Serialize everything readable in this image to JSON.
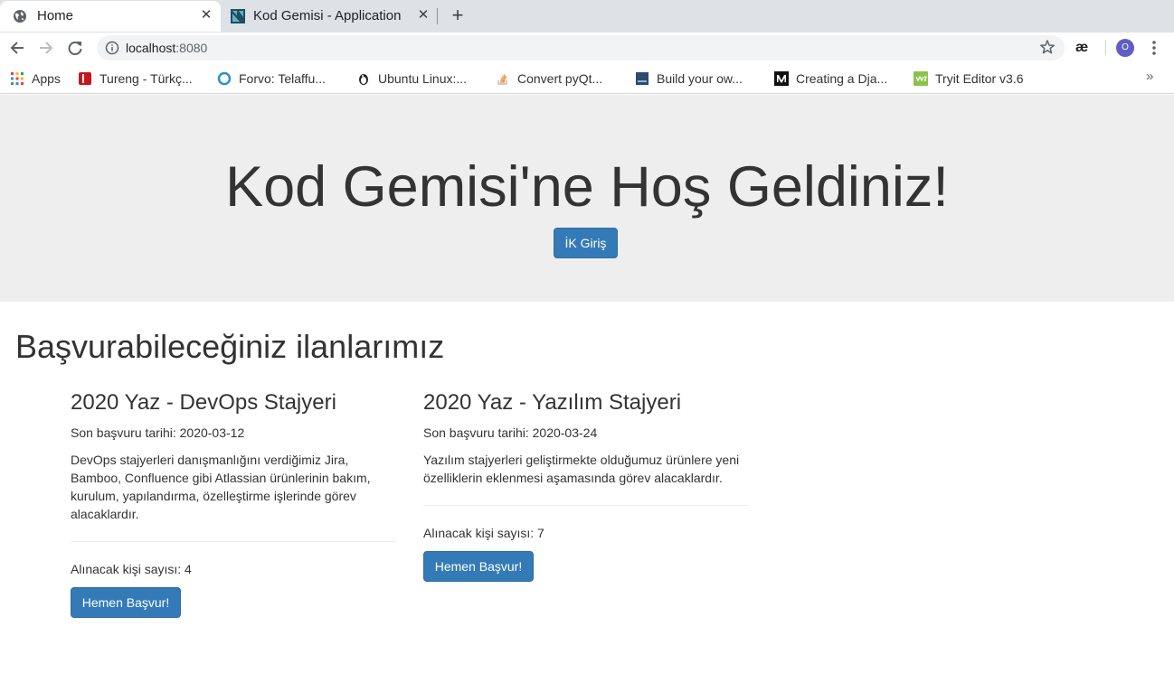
{
  "browser": {
    "tabs": [
      {
        "title": "Home",
        "favicon": "globe-icon",
        "close": "✕",
        "active": true
      },
      {
        "title": "Kod Gemisi - Application",
        "favicon": "kod-gemisi-logo-icon",
        "close": "✕",
        "active": false
      }
    ],
    "new_tab": "+",
    "url_host": "localhost",
    "url_port": ":8080",
    "extension_label": "æ",
    "profile_initial": "O",
    "bookmarks": [
      {
        "label": "Apps",
        "icon": "apps-grid-icon"
      },
      {
        "label": "Tureng - Türkç...",
        "icon": "tureng-icon"
      },
      {
        "label": "Forvo: Telaffu...",
        "icon": "forvo-icon"
      },
      {
        "label": "Ubuntu Linux:...",
        "icon": "ubuntu-linux-icon"
      },
      {
        "label": "Convert pyQt...",
        "icon": "stackoverflow-icon"
      },
      {
        "label": "Build your ow...",
        "icon": "build-icon"
      },
      {
        "label": "Creating a Dja...",
        "icon": "medium-icon"
      },
      {
        "label": "Tryit Editor v3.6",
        "icon": "w3schools-icon"
      }
    ],
    "bookmarks_more": "»"
  },
  "hero": {
    "title": "Kod Gemisi'ne Hoş Geldiniz!",
    "hr_login_label": "İK Giriş"
  },
  "listings": {
    "heading": "Başvurabileceğiniz ilanlarımız",
    "jobs": [
      {
        "title": "2020 Yaz - DevOps Stajyeri",
        "deadline": "Son başvuru tarihi: 2020-03-12",
        "description": "DevOps stajyerleri danışmanlığını verdiğimiz Jira, Bamboo, Confluence gibi Atlassian ürünlerinin bakım, kurulum, yapılandırma, özelleştirme işlerinde görev alacaklardır.",
        "headcount": "Alınacak kişi sayısı: 4",
        "apply_label": "Hemen Başvur!"
      },
      {
        "title": "2020 Yaz - Yazılım Stajyeri",
        "deadline": "Son başvuru tarihi: 2020-03-24",
        "description": "Yazılım stajyerleri geliştirmekte olduğumuz ürünlere yeni özelliklerin eklenmesi aşamasında görev alacaklardır.",
        "headcount": "Alınacak kişi sayısı: 7",
        "apply_label": "Hemen Başvur!"
      }
    ]
  },
  "colors": {
    "primary_button": "#337ab7",
    "jumbotron_bg": "#eeeeee",
    "tabstrip_bg": "#dee1e6",
    "profile_avatar": "#5e5ec4"
  }
}
